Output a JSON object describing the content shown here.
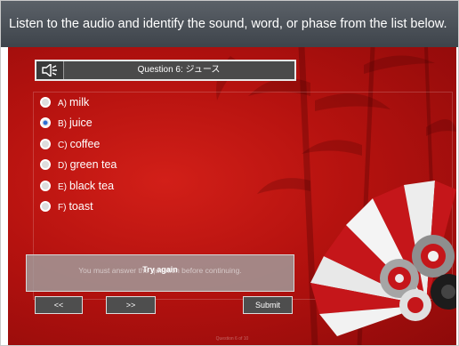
{
  "instruction": "Listen to the audio and identify the sound, word, or phase from the list below.",
  "question": {
    "title": "Question 6:  ジュース",
    "audio_icon": "speaker-icon"
  },
  "options": [
    {
      "letter": "A)",
      "text": "milk",
      "selected": false
    },
    {
      "letter": "B)",
      "text": "juice",
      "selected": true
    },
    {
      "letter": "C)",
      "text": "coffee",
      "selected": false
    },
    {
      "letter": "D)",
      "text": "green tea",
      "selected": false
    },
    {
      "letter": "E)",
      "text": "black tea",
      "selected": false
    },
    {
      "letter": "F)",
      "text": "toast",
      "selected": false
    }
  ],
  "message": {
    "text": "You must answer the question before continuing.",
    "try_again": "Try again"
  },
  "buttons": {
    "prev": "<<",
    "next": ">>",
    "submit": "Submit"
  },
  "footer": "Question 6 of 10",
  "colors": {
    "header": "#4a5057",
    "background": "#b5120f",
    "selected_radio": "#2d6fd6"
  }
}
